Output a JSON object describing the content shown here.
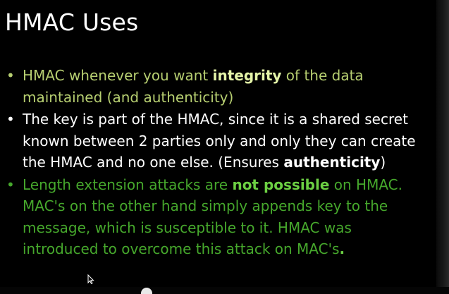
{
  "slide": {
    "title": "HMAC Uses",
    "bullets": [
      {
        "marker": "•",
        "color": "#b7cf71",
        "parts": [
          {
            "text": "HMAC whenever you want ",
            "bold": false
          },
          {
            "text": "integrity",
            "bold": true
          },
          {
            "text": " of the data maintained (and authenticity)",
            "bold": false
          }
        ]
      },
      {
        "marker": "•",
        "color": "#ffffff",
        "parts": [
          {
            "text": "The key is part of the HMAC, since it is a shared secret known between 2 parties only and only they can create the HMAC and no one else. (Ensures ",
            "bold": false
          },
          {
            "text": "authenticity",
            "bold": true
          },
          {
            "text": ")",
            "bold": false
          }
        ]
      },
      {
        "marker": "•",
        "color": "#46a82c",
        "parts": [
          {
            "text": "Length extension attacks are ",
            "bold": false
          },
          {
            "text": "not possible",
            "bold": true
          },
          {
            "text": " on HMAC. MAC's on the other hand simply appends key to the message, which is susceptible to it. HMAC was introduced to overcome this attack on MAC's",
            "bold": false
          },
          {
            "text": ".",
            "bold": true
          }
        ]
      }
    ]
  },
  "icons": {
    "cursor": "mouse-pointer-icon"
  }
}
